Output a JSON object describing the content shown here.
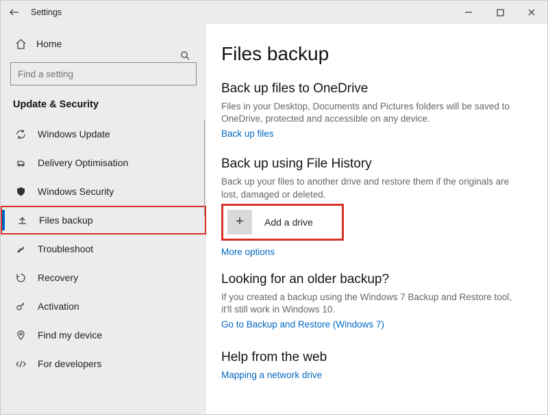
{
  "titlebar": {
    "title": "Settings"
  },
  "sidebar": {
    "home": "Home",
    "search_placeholder": "Find a setting",
    "section": "Update & Security",
    "items": [
      {
        "label": "Windows Update"
      },
      {
        "label": "Delivery Optimisation"
      },
      {
        "label": "Windows Security"
      },
      {
        "label": "Files backup"
      },
      {
        "label": "Troubleshoot"
      },
      {
        "label": "Recovery"
      },
      {
        "label": "Activation"
      },
      {
        "label": "Find my device"
      },
      {
        "label": "For developers"
      }
    ]
  },
  "main": {
    "page_title": "Files backup",
    "onedrive": {
      "heading": "Back up files to OneDrive",
      "desc": "Files in your Desktop, Documents and Pictures folders will be saved to OneDrive, protected and accessible on any device.",
      "link": "Back up files"
    },
    "filehistory": {
      "heading": "Back up using File History",
      "desc": "Back up your files to another drive and restore them if the originals are lost, damaged or deleted.",
      "add_label": "Add a drive",
      "more": "More options"
    },
    "older": {
      "heading": "Looking for an older backup?",
      "desc": "If you created a backup using the Windows 7 Backup and Restore tool, it'll still work in Windows 10.",
      "link": "Go to Backup and Restore (Windows 7)"
    },
    "help": {
      "heading": "Help from the web",
      "link": "Mapping a network drive"
    }
  }
}
